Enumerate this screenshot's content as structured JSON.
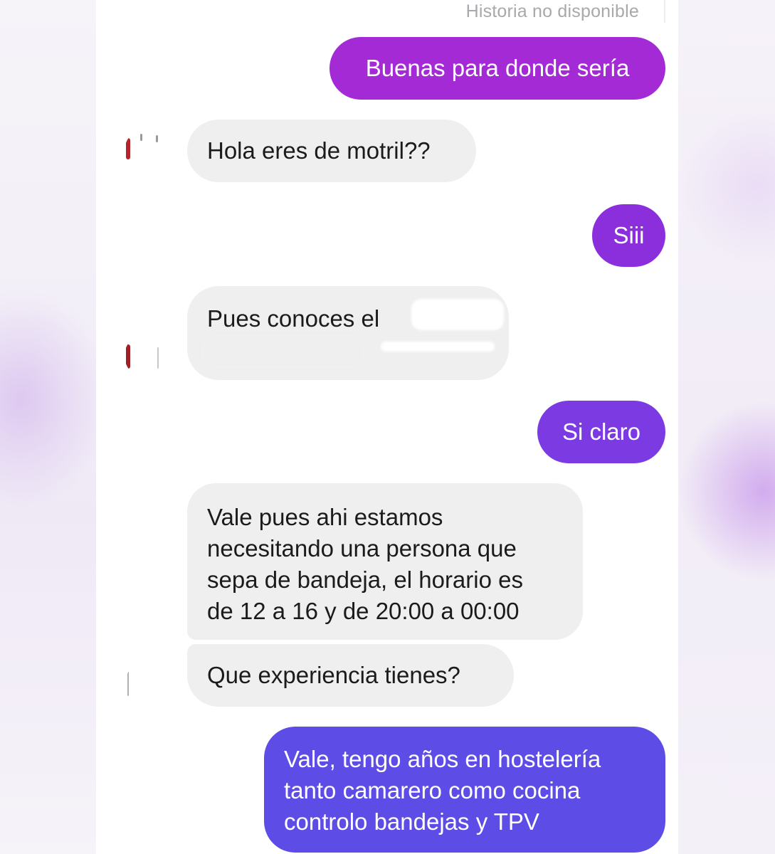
{
  "header": {
    "status": "Historia no disponible"
  },
  "messages": [
    {
      "direction": "out",
      "text": "Buenas para donde sería"
    },
    {
      "direction": "in",
      "text": "Hola eres de motril??"
    },
    {
      "direction": "out",
      "text": "Siii"
    },
    {
      "direction": "in",
      "text": "Pues conoces el"
    },
    {
      "direction": "out",
      "text": "Si claro"
    },
    {
      "direction": "in",
      "text": "Vale pues ahi estamos\nnecesitando una persona que\nsepa de bandeja, el horario es\nde 12 a 16 y de 20:00 a 00:00"
    },
    {
      "direction": "in",
      "text": "Que experiencia tienes?"
    },
    {
      "direction": "out",
      "text": "Vale, tengo años en hostelería\ntanto camarero como cocina\ncontrolo bandejas y TPV"
    }
  ],
  "colors": {
    "outgoing_top": "#a32ad4",
    "outgoing_mid": "#8b2fdd",
    "outgoing_bottom": "#5d4ce6",
    "incoming": "#efefef",
    "status_text": "#a9a9ad"
  }
}
